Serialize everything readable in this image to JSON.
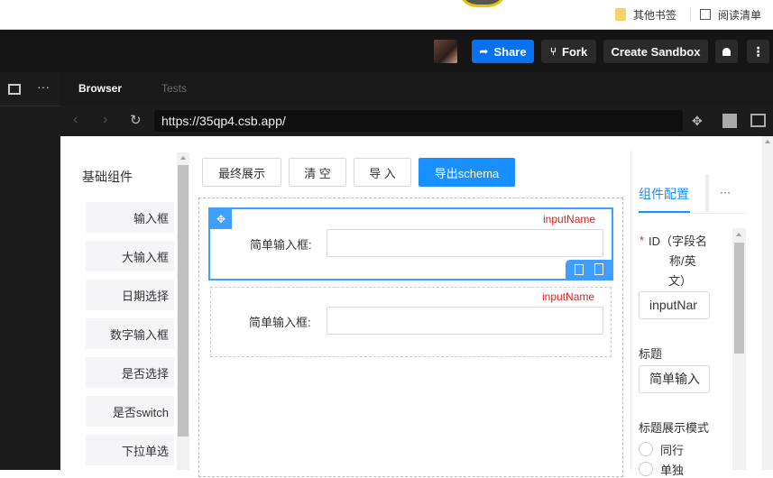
{
  "chrome": {
    "bookmarks": [
      {
        "label": "其他书签",
        "icon": "folder-icon"
      },
      {
        "label": "阅读清单",
        "icon": "reading-list-icon"
      }
    ]
  },
  "csb": {
    "share_label": "Share",
    "fork_label": "Fork",
    "create_label": "Create Sandbox"
  },
  "browser": {
    "tabs": [
      "Browser",
      "Tests"
    ],
    "url": "https://35qp4.csb.app/"
  },
  "app": {
    "sidebar_title": "基础组件",
    "components": [
      "输入框",
      "大输入框",
      "日期选择",
      "数字输入框",
      "是否选择",
      "是否switch",
      "下拉单选"
    ],
    "toolbar": {
      "final_label": "最终展示",
      "clear_label": "清 空",
      "import_label": "导 入",
      "export_label": "导出schema"
    },
    "fields": [
      {
        "name": "inputName",
        "label": "简单输入框:"
      },
      {
        "name": "inputName",
        "label": "简单输入框:"
      }
    ],
    "config": {
      "tab_label": "组件配置",
      "more_label": "···",
      "id_required": "*",
      "id_label_lines": [
        "ID（字段名",
        "称/英",
        "文）"
      ],
      "id_value": "inputNar",
      "title_label": "标题",
      "title_value": "简单输入",
      "mode_label": "标题展示模式",
      "mode_options": [
        "同行",
        "单独"
      ]
    }
  }
}
